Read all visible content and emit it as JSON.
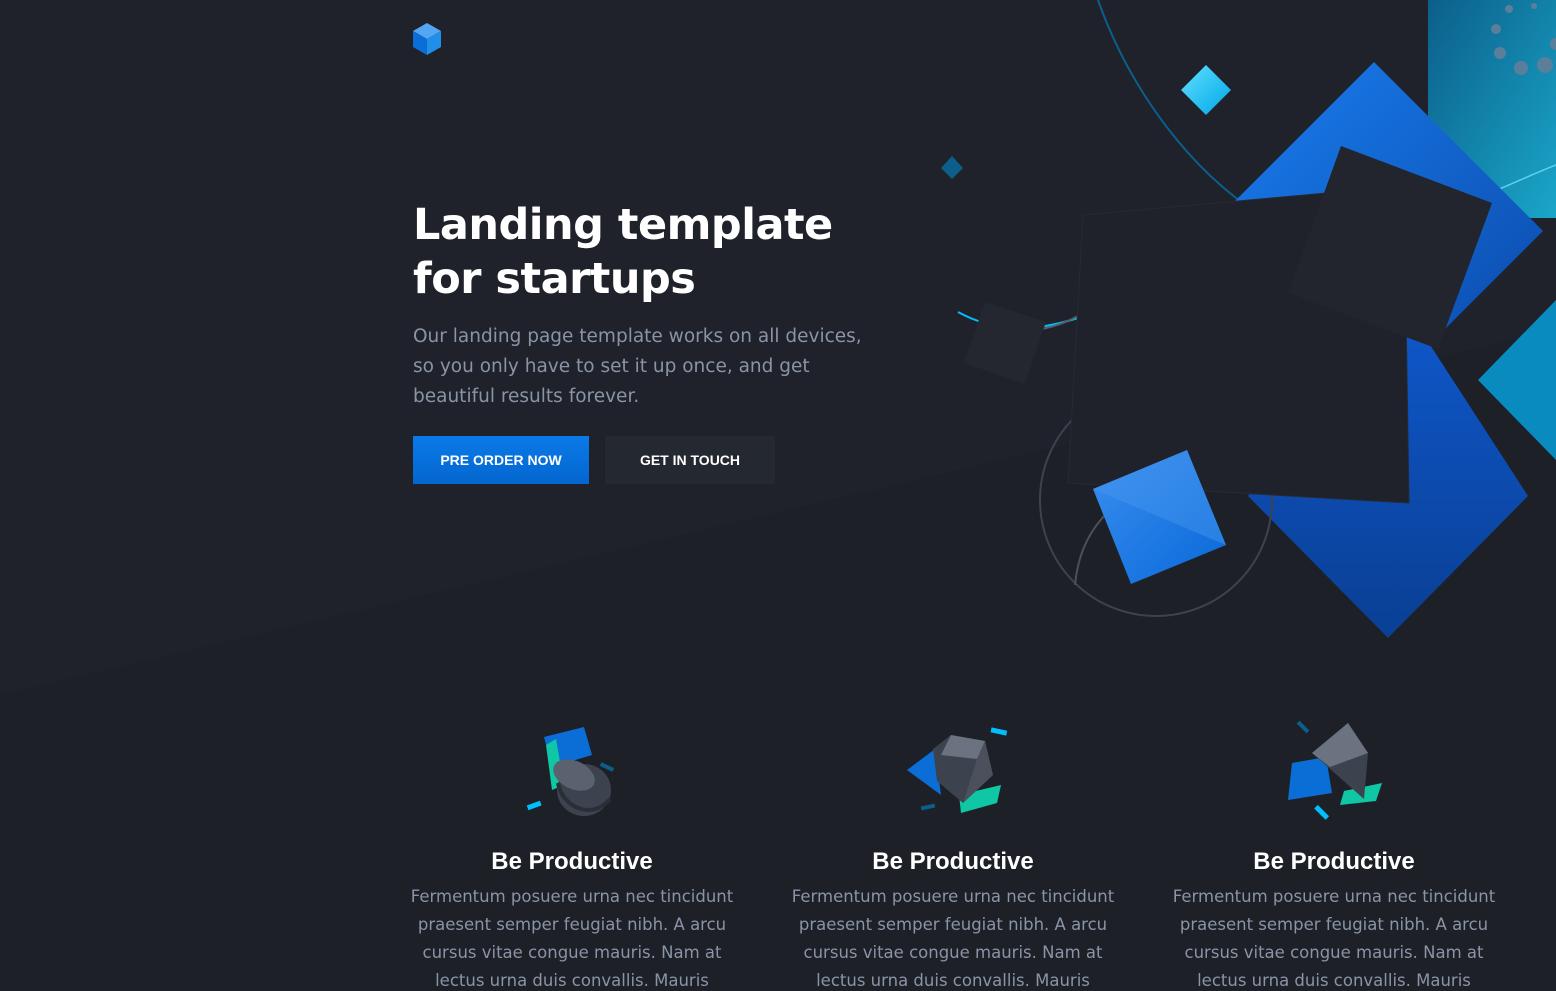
{
  "hero": {
    "title": "Landing template for startups",
    "description": "Our landing page template works on all devices, so you only have to set it up once, and get beautiful results forever.",
    "primary_button": "PRE ORDER NOW",
    "secondary_button": "GET IN TOUCH"
  },
  "features": [
    {
      "icon": "cylinder-shapes-icon",
      "title": "Be Productive",
      "text": "Fermentum posuere urna nec tincidunt praesent semper feugiat nibh. A arcu cursus vitae congue mauris. Nam at lectus urna duis convallis. Mauris"
    },
    {
      "icon": "cube-shapes-icon",
      "title": "Be Productive",
      "text": "Fermentum posuere urna nec tincidunt praesent semper feugiat nibh. A arcu cursus vitae congue mauris. Nam at lectus urna duis convallis. Mauris"
    },
    {
      "icon": "pyramid-shapes-icon",
      "title": "Be Productive",
      "text": "Fermentum posuere urna nec tincidunt praesent semper feugiat nibh. A arcu cursus vitae congue mauris. Nam at lectus urna duis convallis. Mauris"
    }
  ],
  "colors": {
    "background": "#1d2026",
    "primary": "#0270d7",
    "accent_cyan": "#00bffb",
    "accent_green": "#0fc7a4",
    "text_muted": "#8a94a7"
  }
}
